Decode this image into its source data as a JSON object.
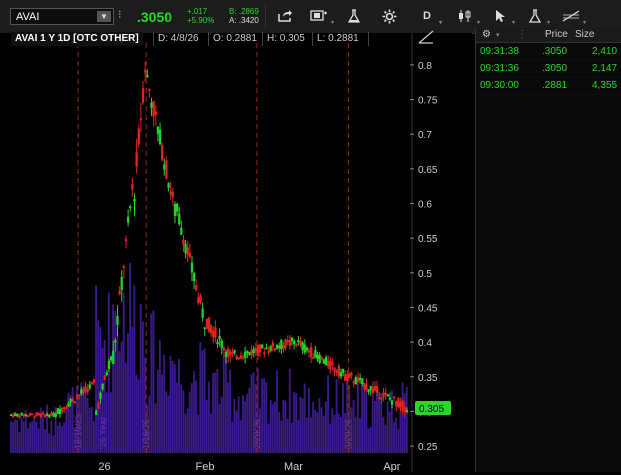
{
  "toolbar": {
    "symbol": "AVAI",
    "last": ".3050",
    "change": "+.017",
    "change_pct": "+5.90%",
    "bid": "B: .2869",
    "ask": "A: .3420",
    "aggregation_label": "D"
  },
  "chart_header": {
    "title": "AVAI 1 Y 1D [OTC OTHER]",
    "date": "D: 4/8/26",
    "open": "O: 0.2881",
    "high": "H: 0.305",
    "low": "L: 0.2881"
  },
  "time_sales": {
    "columns": [
      "Price",
      "Size"
    ],
    "rows": [
      {
        "time": "09:31:38",
        "price": ".3050",
        "size": "2,410"
      },
      {
        "time": "09:31:36",
        "price": ".3050",
        "size": "2,147"
      },
      {
        "time": "09:30:00",
        "price": ".2881",
        "size": "4,355"
      }
    ]
  },
  "colors": {
    "up": "#28d728",
    "down": "#e02424",
    "volume": "#3a1a8c",
    "divider": "#a02020"
  },
  "chart_data": {
    "type": "candlestick",
    "title": "AVAI 1 Y 1D [OTC OTHER]",
    "ylim": [
      0.24,
      0.82
    ],
    "yticks": [
      0.25,
      0.3,
      0.35,
      0.4,
      0.45,
      0.5,
      0.55,
      0.6,
      0.65,
      0.7,
      0.75,
      0.8
    ],
    "ytick_labels": [
      "0.25",
      "0.3",
      "0.35",
      "0.4",
      "0.45",
      "0.5",
      "0.55",
      "0.6",
      "0.65",
      "0.7",
      "0.75",
      "0.8"
    ],
    "x_labels": [
      "26",
      "Feb",
      "Mar",
      "Apr"
    ],
    "last_price_label": "0.305",
    "event_labels": [
      "12/19/25",
      "1/16/26",
      "2/20/26",
      "3/20/26"
    ],
    "note_label": "'26 Year",
    "segments": [
      {
        "from": 0.295,
        "to": 0.295,
        "n": 22,
        "amp": 0.006,
        "vol": 0.35
      },
      {
        "from": 0.3,
        "to": 0.34,
        "n": 18,
        "amp": 0.012,
        "vol": 0.5
      },
      {
        "from": 0.3,
        "to": 0.38,
        "n": 8,
        "amp": 0.015,
        "vol": 1.2
      },
      {
        "from": 0.38,
        "to": 0.62,
        "n": 10,
        "amp": 0.03,
        "vol": 1.5
      },
      {
        "from": 0.62,
        "to": 0.8,
        "n": 6,
        "amp": 0.04,
        "vol": 1.4
      },
      {
        "from": 0.78,
        "to": 0.59,
        "n": 14,
        "amp": 0.03,
        "vol": 1.0
      },
      {
        "from": 0.59,
        "to": 0.43,
        "n": 14,
        "amp": 0.025,
        "vol": 0.8
      },
      {
        "from": 0.43,
        "to": 0.38,
        "n": 12,
        "amp": 0.02,
        "vol": 0.7
      },
      {
        "from": 0.38,
        "to": 0.4,
        "n": 30,
        "amp": 0.015,
        "vol": 0.6
      },
      {
        "from": 0.4,
        "to": 0.35,
        "n": 25,
        "amp": 0.015,
        "vol": 0.55
      },
      {
        "from": 0.35,
        "to": 0.305,
        "n": 28,
        "amp": 0.015,
        "vol": 0.5
      }
    ]
  }
}
